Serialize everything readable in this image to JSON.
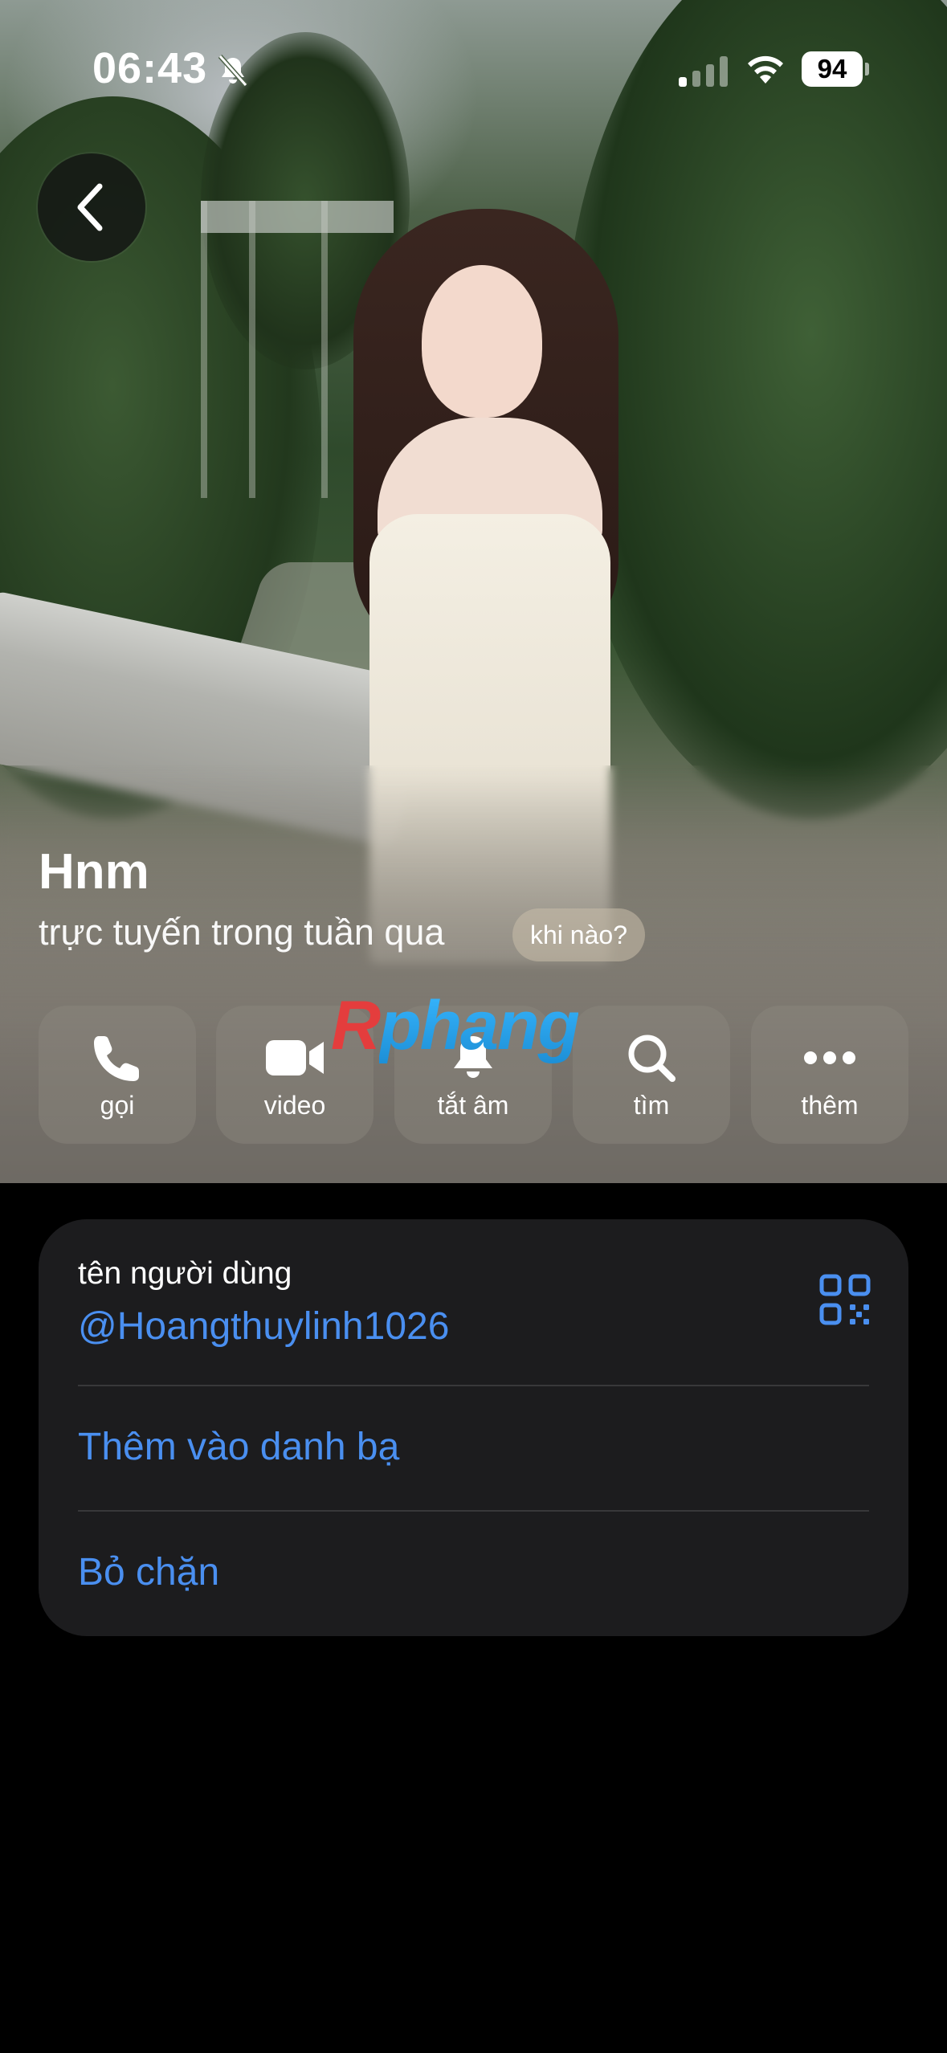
{
  "status_bar": {
    "time": "06:43",
    "battery": "94",
    "icons": [
      "bell-slash-icon",
      "cellular-signal-icon",
      "wifi-icon",
      "battery-icon"
    ],
    "signal_bars_active": 1,
    "signal_bars_total": 4
  },
  "nav": {
    "back_icon": "chevron-left-icon"
  },
  "profile": {
    "name": "Hnm",
    "last_seen": "trực tuyến trong tuần qua",
    "when_button": "khi nào?"
  },
  "actions": [
    {
      "label": "gọi",
      "icon": "phone-icon"
    },
    {
      "label": "video",
      "icon": "video-camera-icon"
    },
    {
      "label": "tắt âm",
      "icon": "bell-icon"
    },
    {
      "label": "tìm",
      "icon": "search-icon"
    },
    {
      "label": "thêm",
      "icon": "more-icon"
    }
  ],
  "watermark": {
    "first": "R",
    "rest": "phang"
  },
  "info": {
    "username_label": "tên người dùng",
    "username": "@Hoangthuylinh1026",
    "qr_icon": "qr-code-icon",
    "add_contact": "Thêm vào danh bạ",
    "unblock": "Bỏ chặn"
  },
  "colors": {
    "link": "#4a8ff0",
    "card_bg": "#1c1c1e",
    "background": "#000000"
  }
}
